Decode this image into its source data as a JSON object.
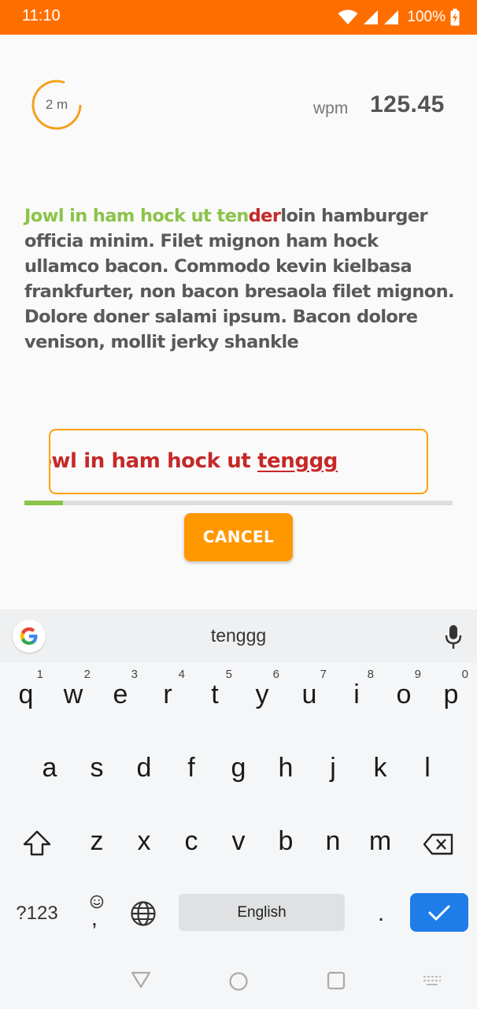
{
  "status_bar": {
    "time": "11:10",
    "battery": "100%",
    "background": "#ff6f00"
  },
  "timer": {
    "label": "2 m"
  },
  "wpm": {
    "label": "wpm",
    "value": "125.45"
  },
  "passage": {
    "correct": "Jowl in ham hock ut ten",
    "error": "der",
    "remaining": "loin hamburger officia minim. Filet mignon ham hock ullamco bacon. Commodo kevin kielbasa frankfurter, non bacon bresaola filet mignon. Dolore doner salami ipsum. Bacon dolore venison, mollit jerky shankle"
  },
  "input": {
    "typed_prefix": "Jowl in ham hock ut ",
    "current_word": "tenggg"
  },
  "progress": {
    "fraction": 0.09
  },
  "cancel_label": "CANCEL",
  "keyboard": {
    "suggestion": "tenggg",
    "row1": [
      {
        "char": "q",
        "hint": "1"
      },
      {
        "char": "w",
        "hint": "2"
      },
      {
        "char": "e",
        "hint": "3"
      },
      {
        "char": "r",
        "hint": "4"
      },
      {
        "char": "t",
        "hint": "5"
      },
      {
        "char": "y",
        "hint": "6"
      },
      {
        "char": "u",
        "hint": "7"
      },
      {
        "char": "i",
        "hint": "8"
      },
      {
        "char": "o",
        "hint": "9"
      },
      {
        "char": "p",
        "hint": "0"
      }
    ],
    "row2": [
      "a",
      "s",
      "d",
      "f",
      "g",
      "h",
      "j",
      "k",
      "l"
    ],
    "row3": [
      "z",
      "x",
      "c",
      "v",
      "b",
      "n",
      "m"
    ],
    "symbols_label": "?123",
    "comma_label": ",",
    "space_label": "English",
    "period_label": "."
  },
  "colors": {
    "accent": "#ff9800",
    "correct": "#8bc34a",
    "error": "#c62828",
    "enter": "#1e7de8"
  }
}
